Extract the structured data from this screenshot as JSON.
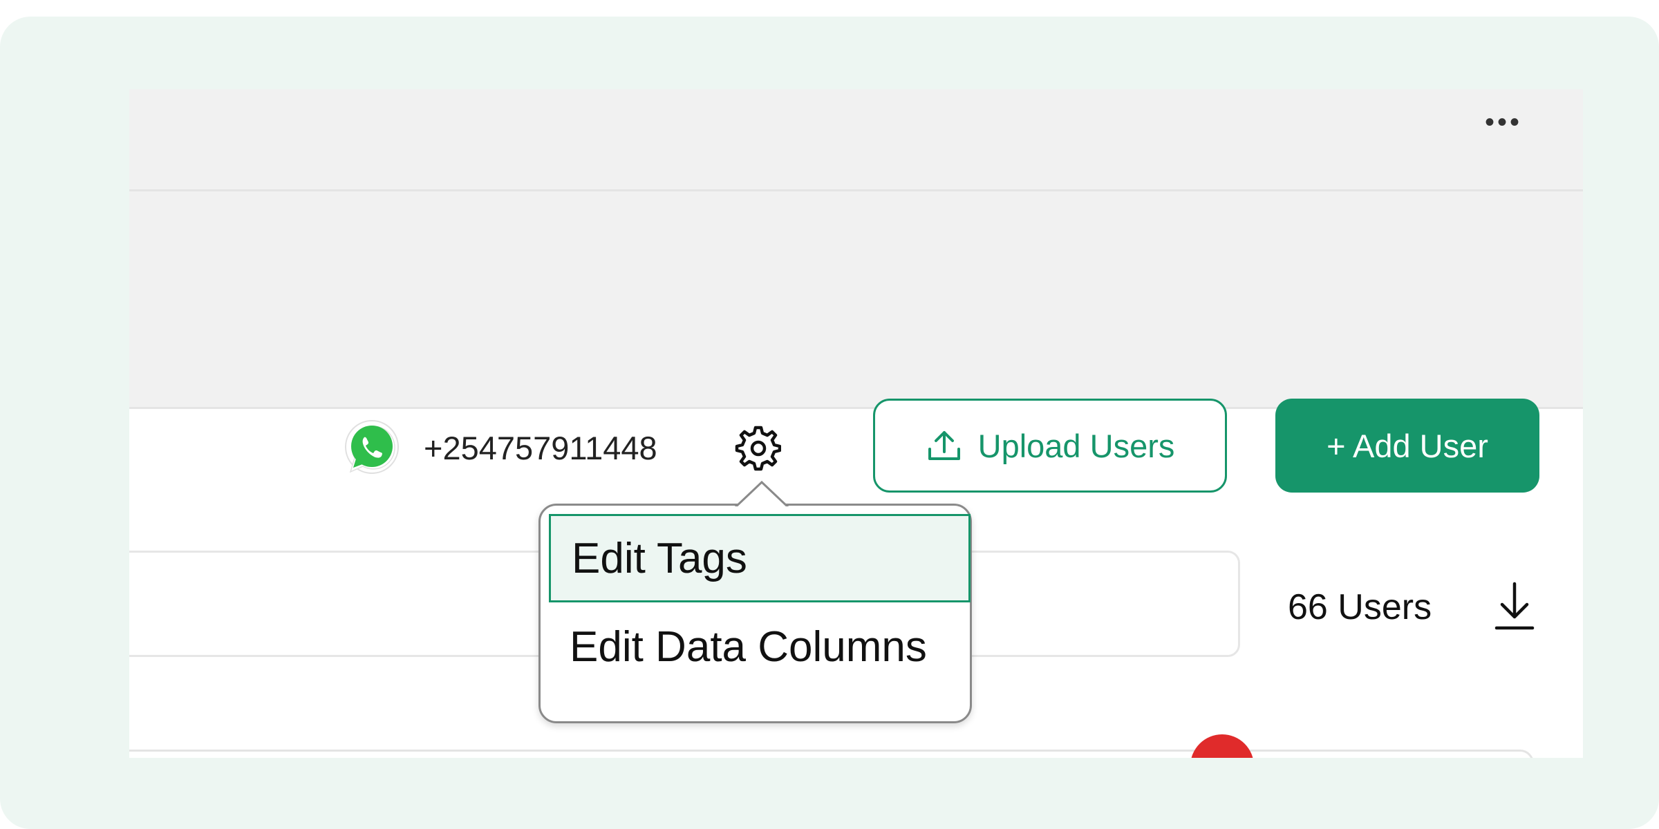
{
  "header": {
    "more_label": "•••"
  },
  "channel": {
    "icon": "whatsapp-icon",
    "phone": "+254757911448",
    "settings_icon": "gear-icon"
  },
  "actions": {
    "upload_label": "Upload Users",
    "upload_icon": "upload-icon",
    "add_label": "+ Add User"
  },
  "summary": {
    "user_count": "66 Users",
    "download_icon": "download-icon"
  },
  "settings_menu": {
    "items": [
      {
        "label": "Edit Tags",
        "active": true
      },
      {
        "label": "Edit Data Columns",
        "active": false
      }
    ]
  },
  "colors": {
    "accent": "#16956a",
    "background": "#edf6f2",
    "bar": "#f1f1f1",
    "alert": "#e02b2b"
  }
}
